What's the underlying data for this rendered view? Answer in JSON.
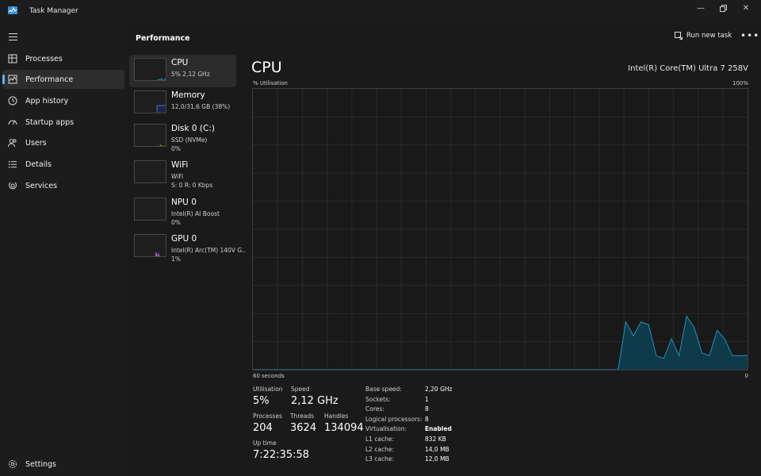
{
  "window": {
    "title": "Task Manager"
  },
  "nav": {
    "items": [
      {
        "label": "Processes"
      },
      {
        "label": "Performance"
      },
      {
        "label": "App history"
      },
      {
        "label": "Startup apps"
      },
      {
        "label": "Users"
      },
      {
        "label": "Details"
      },
      {
        "label": "Services"
      }
    ],
    "settings": "Settings"
  },
  "header": {
    "title": "Performance",
    "run_task": "Run new task",
    "more": "•••"
  },
  "perf_list": [
    {
      "name": "CPU",
      "lines": [
        "5%  2,12 GHz"
      ]
    },
    {
      "name": "Memory",
      "lines": [
        "12,0/31,6 GB (38%)"
      ]
    },
    {
      "name": "Disk 0 (C:)",
      "lines": [
        "SSD (NVMe)",
        "0%"
      ]
    },
    {
      "name": "WiFi",
      "lines": [
        "WiFi",
        "S: 0  R: 0 Kbps"
      ]
    },
    {
      "name": "NPU 0",
      "lines": [
        "Intel(R) AI Boost",
        "0%"
      ]
    },
    {
      "name": "GPU 0",
      "lines": [
        "Intel(R) Arc(TM) 140V G..",
        "1%"
      ]
    }
  ],
  "detail": {
    "title": "CPU",
    "model": "Intel(R) Core(TM) Ultra 7 258V",
    "y_label": "% Utilisation",
    "y_max": "100%",
    "x_left": "60 seconds",
    "x_right": "0",
    "stats": {
      "utilisation_label": "Utilisation",
      "utilisation": "5%",
      "speed_label": "Speed",
      "speed": "2,12 GHz",
      "processes_label": "Processes",
      "processes": "204",
      "threads_label": "Threads",
      "threads": "3624",
      "handles_label": "Handles",
      "handles": "134094",
      "uptime_label": "Up time",
      "uptime": "7:22:35:58"
    },
    "specs": [
      {
        "k": "Base speed:",
        "v": "2,20 GHz"
      },
      {
        "k": "Sockets:",
        "v": "1"
      },
      {
        "k": "Cores:",
        "v": "8"
      },
      {
        "k": "Logical processors:",
        "v": "8"
      },
      {
        "k": "Virtualisation:",
        "v": "Enabled"
      },
      {
        "k": "L1 cache:",
        "v": "832 KB"
      },
      {
        "k": "L2 cache:",
        "v": "14,0 MB"
      },
      {
        "k": "L3 cache:",
        "v": "12,0 MB"
      }
    ]
  },
  "colors": {
    "accent": "#5fb2f2",
    "cpu_line": "#1b95bd",
    "cpu_fill": "#0e3a4a",
    "memory": "#6d76d8",
    "disk": "#6bbf2f",
    "gpu": "#b466d6"
  },
  "chart_data": {
    "type": "area",
    "x_range_seconds": [
      60,
      0
    ],
    "ylim": [
      0,
      100
    ],
    "series": [
      {
        "values": [
          0,
          0,
          0,
          0,
          0,
          0,
          0,
          0,
          0,
          0,
          0,
          0,
          0,
          0,
          0,
          0,
          0,
          0,
          0,
          0,
          0,
          0,
          0,
          0,
          0,
          0,
          0,
          0,
          0,
          0,
          0,
          0,
          0,
          0,
          0,
          0,
          0,
          0,
          0,
          0,
          0,
          0,
          0,
          0,
          0,
          0,
          0,
          0,
          0,
          17,
          12,
          17,
          16,
          5,
          4,
          11,
          5,
          19,
          15,
          6,
          5,
          14,
          11,
          5,
          5,
          5
        ]
      }
    ]
  }
}
